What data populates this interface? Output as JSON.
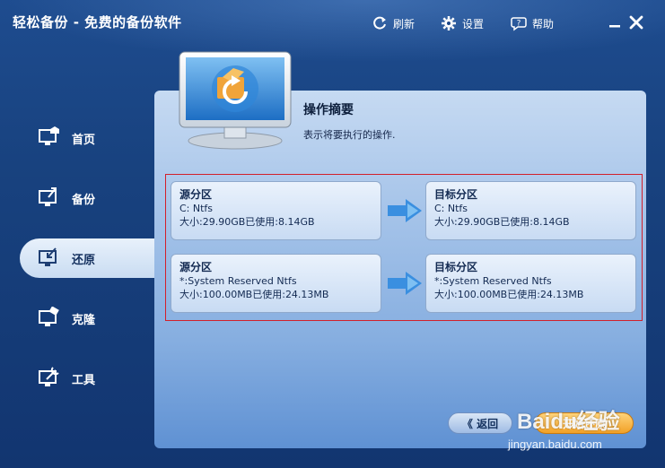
{
  "window": {
    "title": "轻松备份 - 免费的备份软件"
  },
  "toolbar": {
    "refresh": "刷新",
    "settings": "设置",
    "help": "帮助"
  },
  "sidebar": {
    "items": [
      {
        "label": "首页",
        "icon": "monitor-home-icon"
      },
      {
        "label": "备份",
        "icon": "monitor-backup-icon"
      },
      {
        "label": "还原",
        "icon": "monitor-restore-icon",
        "active": true
      },
      {
        "label": "克隆",
        "icon": "monitor-clone-icon"
      },
      {
        "label": "工具",
        "icon": "monitor-tools-icon"
      }
    ]
  },
  "main": {
    "title": "操作摘要",
    "description": "表示将要执行的操作.",
    "rows": [
      {
        "source": {
          "heading": "源分区",
          "name": "C: Ntfs",
          "size": "大小:29.90GB已使用:8.14GB"
        },
        "target": {
          "heading": "目标分区",
          "name": "C: Ntfs",
          "size": "大小:29.90GB已使用:8.14GB"
        }
      },
      {
        "source": {
          "heading": "源分区",
          "name": "*:System Reserved Ntfs",
          "size": "大小:100.00MB已使用:24.13MB"
        },
        "target": {
          "heading": "目标分区",
          "name": "*:System Reserved Ntfs",
          "size": "大小:100.00MB已使用:24.13MB"
        }
      }
    ]
  },
  "buttons": {
    "back": "《 返回",
    "start": "开始还原"
  },
  "watermark": {
    "brand": "Baidu经验",
    "url": "jingyan.baidu.com"
  },
  "colors": {
    "accent_orange": "#f2a127",
    "frame_red": "#d21f2a",
    "arrow_blue": "#3a8fe0"
  }
}
